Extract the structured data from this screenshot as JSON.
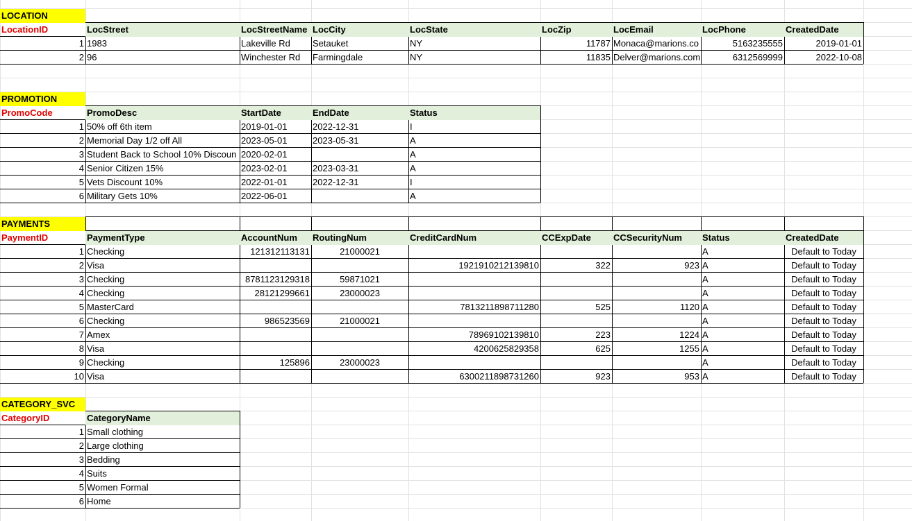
{
  "location": {
    "title": "LOCATION",
    "headers": [
      "LocationID",
      "LocStreet",
      "LocStreetName",
      "LocCity",
      "LocState",
      "LocZip",
      "LocEmail",
      "LocPhone",
      "CreatedDate"
    ],
    "rows": [
      [
        "1",
        "1983",
        "Lakeville Rd",
        "Setauket",
        "NY",
        "11787",
        "Monaca@marions.co",
        "5163235555",
        "2019-01-01"
      ],
      [
        "2",
        "96",
        "Winchester Rd",
        "Farmingdale",
        "NY",
        "11835",
        "Delver@marions.com",
        "6312569999",
        "2022-10-08"
      ]
    ]
  },
  "promotion": {
    "title": "PROMOTION",
    "headers": [
      "PromoCode",
      "PromoDesc",
      "StartDate",
      "EndDate",
      "Status"
    ],
    "rows": [
      [
        "1",
        "50% off 6th item",
        "2019-01-01",
        "2022-12-31",
        "I"
      ],
      [
        "2",
        "Memorial Day 1/2 off All",
        "2023-05-01",
        "2023-05-31",
        "A"
      ],
      [
        "3",
        "Student Back to School 10% Discoun",
        "2020-02-01",
        "",
        "A"
      ],
      [
        "4",
        "Senior Citizen 15%",
        "2023-02-01",
        "2023-03-31",
        "A"
      ],
      [
        "5",
        "Vets Discount 10%",
        "2022-01-01",
        "2022-12-31",
        "I"
      ],
      [
        "6",
        "Military Gets 10%",
        "2022-06-01",
        "",
        "A"
      ]
    ]
  },
  "payments": {
    "title": "PAYMENTS",
    "headers": [
      "PaymentID",
      "PaymentType",
      "AccountNum",
      "RoutingNum",
      "CreditCardNum",
      "CCExpDate",
      "CCSecurityNum",
      "Status",
      "CreatedDate"
    ],
    "rows": [
      [
        "1",
        "Checking",
        "121312113131",
        "21000021",
        "",
        "",
        "",
        "A",
        "Default to Today"
      ],
      [
        "2",
        "Visa",
        "",
        "",
        "1921910212139810",
        "322",
        "923",
        "A",
        "Default to Today"
      ],
      [
        "3",
        "Checking",
        "8781123129318",
        "59871021",
        "",
        "",
        "",
        "A",
        "Default to Today"
      ],
      [
        "4",
        "Checking",
        "28121299661",
        "23000023",
        "",
        "",
        "",
        "A",
        "Default to Today"
      ],
      [
        "5",
        "MasterCard",
        "",
        "",
        "7813211898711280",
        "525",
        "1120",
        "A",
        "Default to Today"
      ],
      [
        "6",
        "Checking",
        "986523569",
        "21000021",
        "",
        "",
        "",
        "A",
        "Default to Today"
      ],
      [
        "7",
        "Amex",
        "",
        "",
        "78969102139810",
        "223",
        "1224",
        "A",
        "Default to Today"
      ],
      [
        "8",
        "Visa",
        "",
        "",
        "4200625829358",
        "625",
        "1255",
        "A",
        "Default to Today"
      ],
      [
        "9",
        "Checking",
        "125896",
        "23000023",
        "",
        "",
        "",
        "A",
        "Default to Today"
      ],
      [
        "10",
        "Visa",
        "",
        "",
        "6300211898731260",
        "923",
        "953",
        "A",
        "Default to Today"
      ]
    ]
  },
  "category": {
    "title": "CATEGORY_SVC",
    "headers": [
      "CategoryID",
      "CategoryName"
    ],
    "rows": [
      [
        "1",
        "Small clothing"
      ],
      [
        "2",
        "Large clothing"
      ],
      [
        "3",
        "Bedding"
      ],
      [
        "4",
        "Suits"
      ],
      [
        "5",
        "Women Formal"
      ],
      [
        "6",
        "Home"
      ]
    ]
  },
  "colors": {
    "title_highlight": "#ffff00",
    "header_fill": "#e2efda",
    "id_header_text": "#e00000",
    "gridline": "#e1e1e1"
  }
}
